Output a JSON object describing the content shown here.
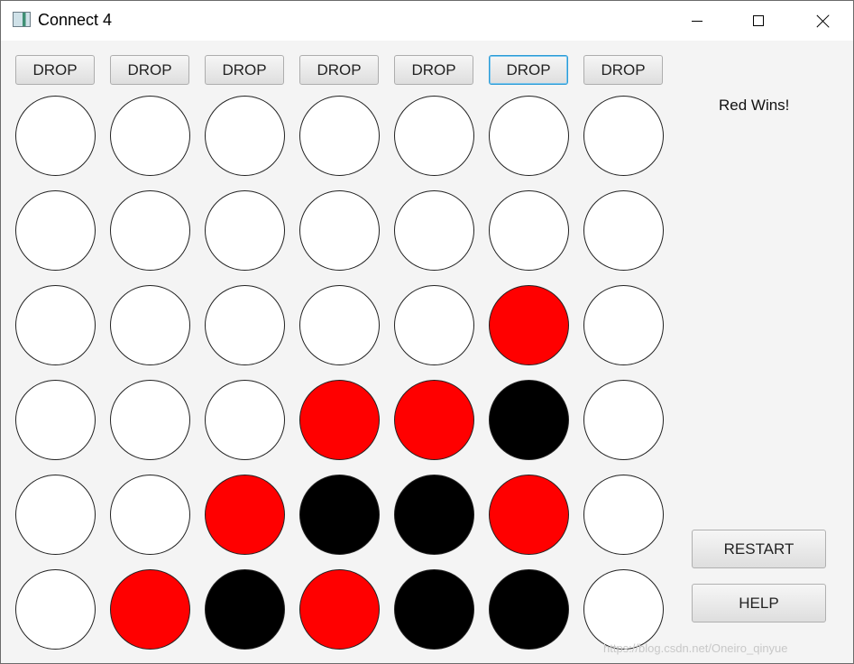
{
  "window": {
    "title": "Connect 4",
    "controls": {
      "minimize": "minimize",
      "maximize": "maximize",
      "close": "close"
    }
  },
  "drop_buttons": [
    "DROP",
    "DROP",
    "DROP",
    "DROP",
    "DROP",
    "DROP",
    "DROP"
  ],
  "focused_drop_column": 6,
  "colors": {
    "empty": "#ffffff",
    "red": "#ff0000",
    "black": "#000000"
  },
  "board": [
    [
      "empty",
      "empty",
      "empty",
      "empty",
      "empty",
      "empty",
      "empty"
    ],
    [
      "empty",
      "empty",
      "empty",
      "empty",
      "empty",
      "empty",
      "empty"
    ],
    [
      "empty",
      "empty",
      "empty",
      "empty",
      "empty",
      "red",
      "empty"
    ],
    [
      "empty",
      "empty",
      "empty",
      "red",
      "red",
      "black",
      "empty"
    ],
    [
      "empty",
      "empty",
      "red",
      "black",
      "black",
      "red",
      "empty"
    ],
    [
      "empty",
      "red",
      "black",
      "red",
      "black",
      "black",
      "empty"
    ]
  ],
  "status_text": "Red Wins!",
  "buttons": {
    "restart": "RESTART",
    "help": "HELP"
  },
  "watermark": "https://blog.csdn.net/Oneiro_qinyue"
}
